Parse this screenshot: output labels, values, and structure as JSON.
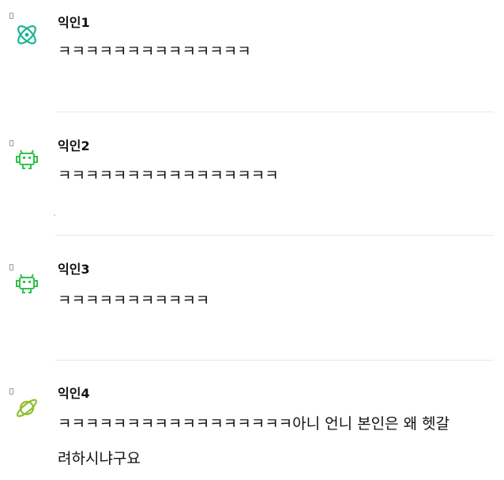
{
  "colors": {
    "teal": "#19b394",
    "green": "#31c24a",
    "lime": "#8cbf2a",
    "divider": "#e9e9e9"
  },
  "comments": [
    {
      "author": "익인1",
      "avatar_icon": "atom-icon",
      "lines": [
        "ㅋㅋㅋㅋㅋㅋㅋㅋㅋㅋㅋㅋㅋㅋ"
      ]
    },
    {
      "author": "익인2",
      "avatar_icon": "space-invader-icon",
      "lines": [
        "ㅋㅋㅋㅋㅋㅋㅋㅋㅋㅋㅋㅋㅋㅋㅋㅋ"
      ]
    },
    {
      "author": "익인3",
      "avatar_icon": "space-invader-icon",
      "lines": [
        "ㅋㅋㅋㅋㅋㅋㅋㅋㅋㅋㅋ"
      ]
    },
    {
      "author": "익인4",
      "avatar_icon": "planet-icon",
      "lines": [
        "ㅋㅋㅋㅋㅋㅋㅋㅋㅋㅋㅋㅋㅋㅋㅋㅋㅋ아니 언니 본인은 왜 헷갈",
        "려하시냐구요"
      ]
    }
  ]
}
